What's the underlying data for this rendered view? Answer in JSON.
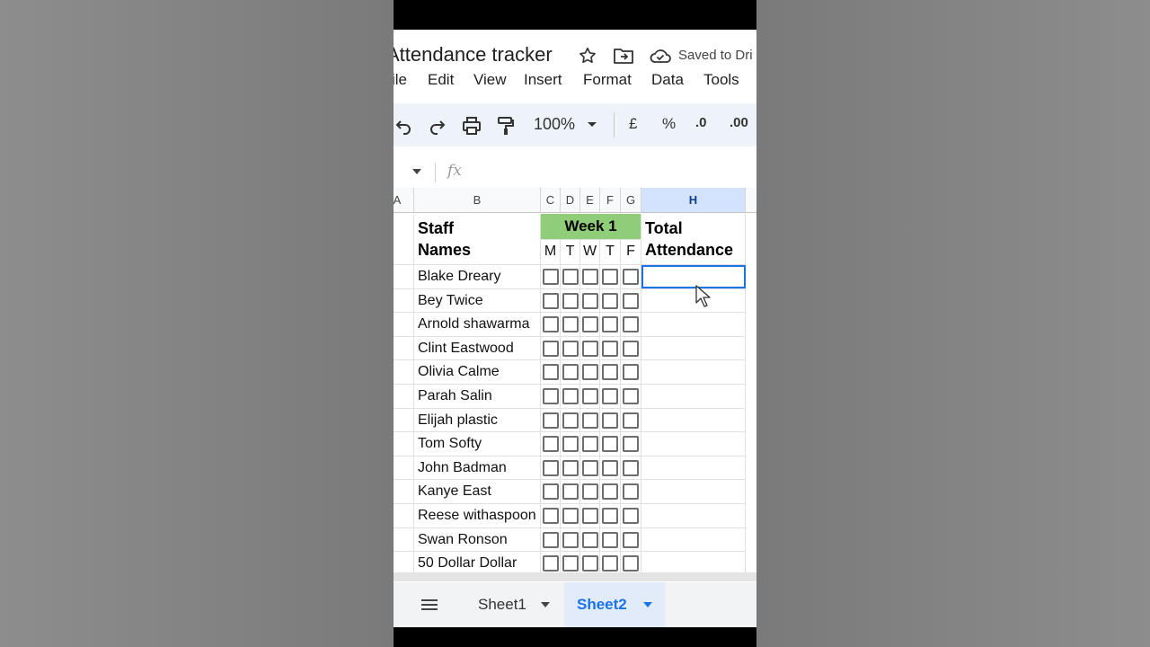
{
  "doc": {
    "title": "Attendance tracker",
    "saved_status": "Saved to Dri"
  },
  "menu": [
    "ile",
    "Edit",
    "View",
    "Insert",
    "Format",
    "Data",
    "Tools"
  ],
  "toolbar": {
    "zoom": "100%",
    "currency": "£",
    "percent": "%",
    "decrease_decimal": ".0",
    "increase_decimal": ".00"
  },
  "formula_bar": {
    "fx": "fx"
  },
  "columns": {
    "a": "A",
    "b": "B",
    "c": "C",
    "d": "D",
    "e": "E",
    "f": "F",
    "g": "G",
    "h": "H"
  },
  "sheet": {
    "staff_header_line1": "Staff",
    "staff_header_line2": "Names",
    "week_label": "Week 1",
    "total_line1": "Total",
    "total_line2": "Attendance",
    "days": [
      "M",
      "T",
      "W",
      "T",
      "F"
    ],
    "staff": [
      "Blake Dreary",
      "Bey Twice",
      "Arnold shawarma",
      "Clint Eastwood",
      "Olivia Calme",
      "Parah Salin",
      "Elijah plastic",
      "Tom Softy",
      "John Badman",
      "Kanye East",
      "Reese withaspoon",
      "Swan Ronson",
      "50 Dollar Dollar"
    ]
  },
  "tabs": [
    "Sheet1",
    "Sheet2"
  ],
  "active_tab": "Sheet2",
  "colors": {
    "week_fill": "#8fcd79",
    "selection": "#1a73e8",
    "toolbar_bg": "#eef2f9"
  }
}
